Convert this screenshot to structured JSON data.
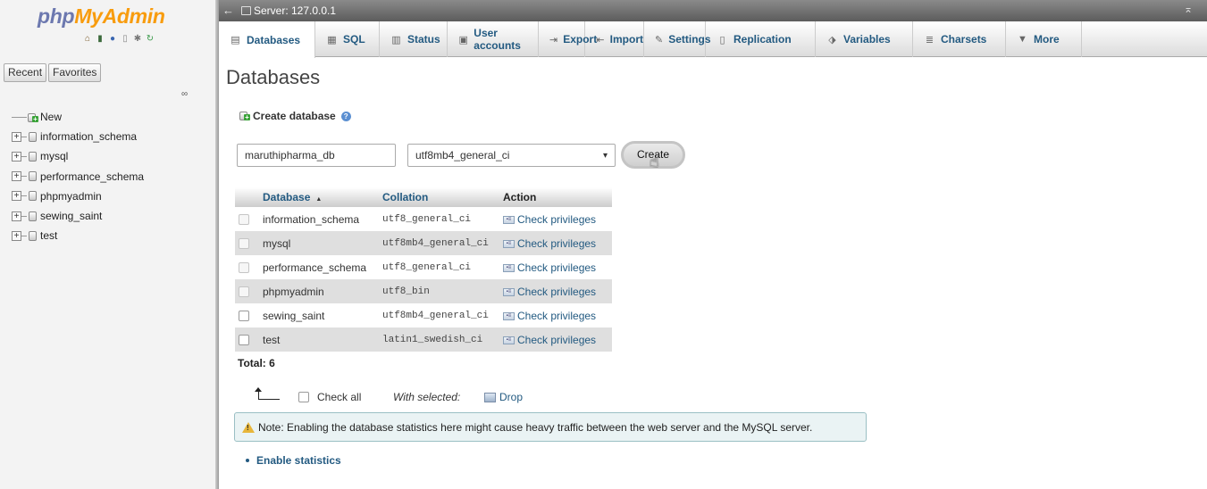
{
  "logo": {
    "part1": "php",
    "part2": "MyAdmin"
  },
  "quick_icons": [
    "home-icon",
    "exit-icon",
    "help-icon",
    "docs-icon",
    "settings-icon",
    "reload-icon"
  ],
  "nav": {
    "tabs": [
      "Recent",
      "Favorites"
    ],
    "new_label": "New",
    "databases": [
      "information_schema",
      "mysql",
      "performance_schema",
      "phpmyadmin",
      "sewing_saint",
      "test"
    ]
  },
  "topbar": {
    "server": "Server: 127.0.0.1"
  },
  "menu": {
    "items": [
      {
        "label": "Databases",
        "icon": "database-icon",
        "glyph": "▤"
      },
      {
        "label": "SQL",
        "icon": "sql-icon",
        "glyph": "▦"
      },
      {
        "label": "Status",
        "icon": "status-icon",
        "glyph": "▥"
      },
      {
        "label": "User accounts",
        "icon": "user-icon",
        "glyph": "▣"
      },
      {
        "label": "Export",
        "icon": "export-icon",
        "glyph": "⇥"
      },
      {
        "label": "Import",
        "icon": "import-icon",
        "glyph": "⇤"
      },
      {
        "label": "Settings",
        "icon": "wrench-icon",
        "glyph": "✎"
      },
      {
        "label": "Replication",
        "icon": "replication-icon",
        "glyph": "▯"
      },
      {
        "label": "Variables",
        "icon": "variables-icon",
        "glyph": "⬗"
      },
      {
        "label": "Charsets",
        "icon": "charsets-icon",
        "glyph": "≣"
      },
      {
        "label": "More",
        "icon": "more-caret-icon",
        "glyph": "▼"
      }
    ]
  },
  "page": {
    "title": "Databases"
  },
  "create": {
    "label": "Create database",
    "name_value": "maruthipharma_db",
    "collation_value": "utf8mb4_general_ci",
    "button_label": "Create"
  },
  "table": {
    "headers": {
      "database": "Database",
      "collation": "Collation",
      "action": "Action"
    },
    "rows": [
      {
        "name": "information_schema",
        "collation": "utf8_general_ci",
        "action": "Check privileges"
      },
      {
        "name": "mysql",
        "collation": "utf8mb4_general_ci",
        "action": "Check privileges"
      },
      {
        "name": "performance_schema",
        "collation": "utf8_general_ci",
        "action": "Check privileges"
      },
      {
        "name": "phpmyadmin",
        "collation": "utf8_bin",
        "action": "Check privileges"
      },
      {
        "name": "sewing_saint",
        "collation": "utf8mb4_general_ci",
        "action": "Check privileges"
      },
      {
        "name": "test",
        "collation": "latin1_swedish_ci",
        "action": "Check privileges"
      }
    ],
    "total": "Total: 6"
  },
  "bulk": {
    "check_all": "Check all",
    "with_selected": "With selected:",
    "drop": "Drop"
  },
  "notice": {
    "text": "Note: Enabling the database statistics here might cause heavy traffic between the web server and the MySQL server."
  },
  "stats": {
    "enable_label": "Enable statistics"
  }
}
